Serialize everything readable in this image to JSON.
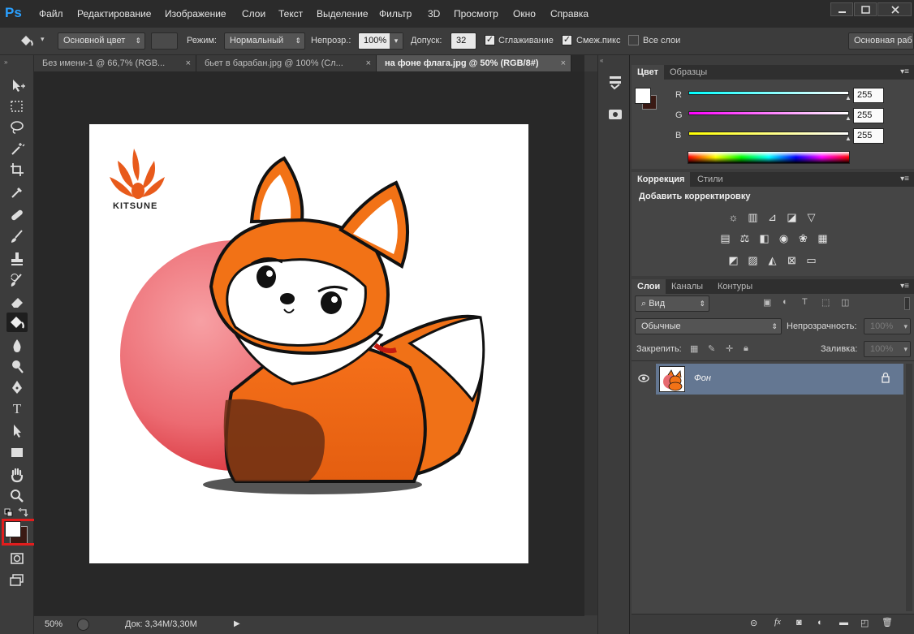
{
  "app": {
    "logo": "Ps",
    "right_button": "Основная раб"
  },
  "menu": [
    "Файл",
    "Редактирование",
    "Изображение",
    "Слои",
    "Текст",
    "Выделение",
    "Фильтр",
    "3D",
    "Просмотр",
    "Окно",
    "Справка"
  ],
  "window_controls": [
    "minimize-icon",
    "maximize-icon",
    "close-icon"
  ],
  "options": {
    "fill_source": "Основной цвет",
    "mode_label": "Режим:",
    "mode_value": "Нормальный",
    "opacity_label": "Непрозр.:",
    "opacity_value": "100%",
    "tolerance_label": "Допуск:",
    "tolerance_value": "32",
    "antialias_label": "Сглаживание",
    "antialias_checked": true,
    "contiguous_label": "Смеж.пикс",
    "contiguous_checked": true,
    "all_layers_label": "Все слои",
    "all_layers_checked": false
  },
  "tabs": [
    {
      "label": "Без имени-1 @ 66,7% (RGB...",
      "close": "×"
    },
    {
      "label": "бьет в барабан.jpg @ 100% (Сл...",
      "close": "×"
    },
    {
      "label": "на фоне флага.jpg @ 50% (RGB/8#)",
      "close": "×",
      "active": true
    }
  ],
  "tools": [
    "move-icon",
    "marquee-icon",
    "lasso-icon",
    "magic-wand-icon",
    "crop-icon",
    "eyedropper-icon",
    "healing-icon",
    "brush-icon",
    "stamp-icon",
    "history-brush-icon",
    "eraser-icon",
    "paint-bucket-icon",
    "blur-icon",
    "dodge-icon",
    "pen-icon",
    "type-icon",
    "path-select-icon",
    "rectangle-icon",
    "hand-icon",
    "zoom-icon"
  ],
  "document": {
    "logo_text": "KITSUNE"
  },
  "status": {
    "zoom": "50%",
    "doc_info": "Док: 3,34M/3,30M"
  },
  "color_panel": {
    "tabs": [
      "Цвет",
      "Образцы"
    ],
    "channels": [
      {
        "label": "R",
        "value": "255",
        "gradient_start": "#00ffff",
        "gradient_end": "#ffffff"
      },
      {
        "label": "G",
        "value": "255",
        "gradient_start": "#ff00ff",
        "gradient_end": "#ffffff"
      },
      {
        "label": "B",
        "value": "255",
        "gradient_start": "#ffff00",
        "gradient_end": "#ffffff"
      }
    ],
    "foreground": "#ffffff",
    "background": "#3a1a14"
  },
  "adjustments_panel": {
    "tabs": [
      "Коррекция",
      "Стили"
    ],
    "title": "Добавить корректировку"
  },
  "layers_panel": {
    "tabs": [
      "Слои",
      "Каналы",
      "Контуры"
    ],
    "filter": "Вид",
    "blend_mode": "Обычные",
    "opacity_label": "Непрозрачность:",
    "opacity_value": "100%",
    "lock_label": "Закрепить:",
    "fill_label": "Заливка:",
    "fill_value": "100%",
    "layers": [
      {
        "name": "Фон",
        "visible": true,
        "locked": true
      }
    ]
  }
}
